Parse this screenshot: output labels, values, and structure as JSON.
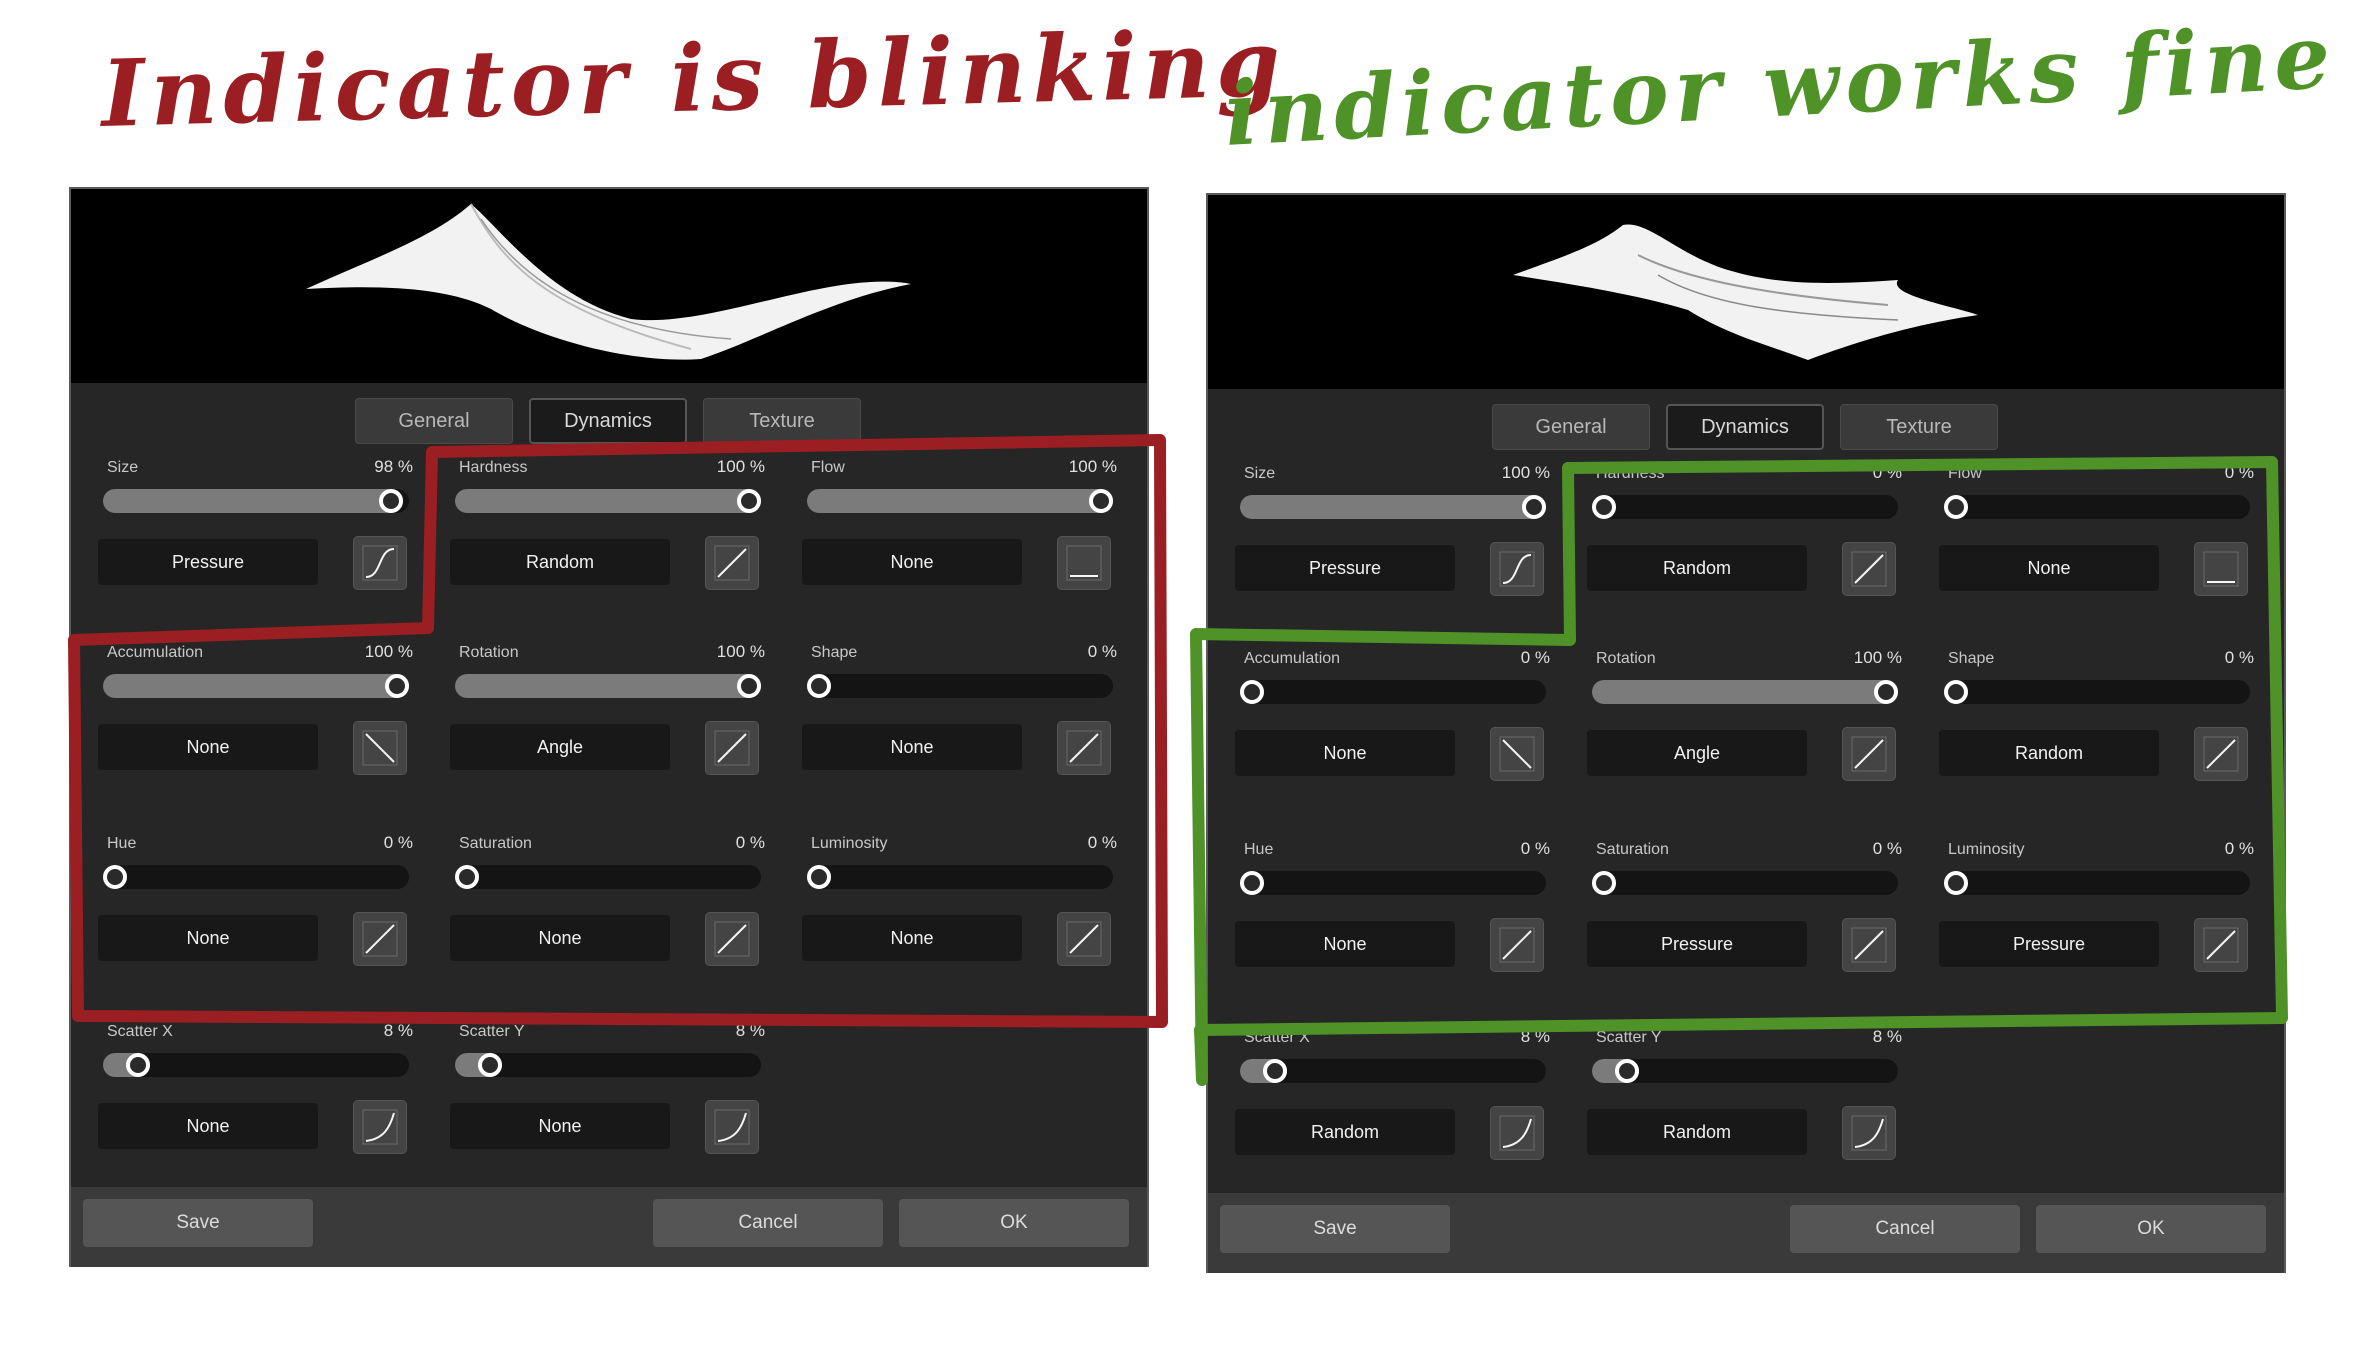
{
  "captions": {
    "left": "Indicator is blinking",
    "right": "indicator works fine"
  },
  "colors": {
    "left_annotation": "#9b1e22",
    "right_annotation": "#4e9228",
    "panel_bg": "#262626",
    "slider_fill": "#7b7b7b"
  },
  "left_panel": {
    "tabs": [
      "General",
      "Dynamics",
      "Texture"
    ],
    "active_tab": "Dynamics",
    "params": [
      {
        "label": "Size",
        "value": "98 %",
        "level": 0.98,
        "mode": "Pressure",
        "curve": "s-curve-icon"
      },
      {
        "label": "Hardness",
        "value": "100 %",
        "level": 1.0,
        "mode": "Random",
        "curve": "linear-curve-icon"
      },
      {
        "label": "Flow",
        "value": "100 %",
        "level": 1.0,
        "mode": "None",
        "curve": "flat-curve-icon"
      },
      {
        "label": "Accumulation",
        "value": "100 %",
        "level": 1.0,
        "mode": "None",
        "curve": "inverse-curve-icon"
      },
      {
        "label": "Rotation",
        "value": "100 %",
        "level": 1.0,
        "mode": "Angle",
        "curve": "linear-curve-icon"
      },
      {
        "label": "Shape",
        "value": "0 %",
        "level": 0.0,
        "mode": "None",
        "curve": "linear-curve-icon"
      },
      {
        "label": "Hue",
        "value": "0 %",
        "level": 0.0,
        "mode": "None",
        "curve": "linear-curve-icon"
      },
      {
        "label": "Saturation",
        "value": "0 %",
        "level": 0.0,
        "mode": "None",
        "curve": "linear-curve-icon"
      },
      {
        "label": "Luminosity",
        "value": "0 %",
        "level": 0.0,
        "mode": "None",
        "curve": "linear-curve-icon"
      },
      {
        "label": "Scatter X",
        "value": "8 %",
        "level": 0.08,
        "mode": "None",
        "curve": "concave-curve-icon"
      },
      {
        "label": "Scatter Y",
        "value": "8 %",
        "level": 0.08,
        "mode": "None",
        "curve": "concave-curve-icon"
      }
    ],
    "footer": {
      "save": "Save",
      "cancel": "Cancel",
      "ok": "OK"
    }
  },
  "right_panel": {
    "tabs": [
      "General",
      "Dynamics",
      "Texture"
    ],
    "active_tab": "Dynamics",
    "params": [
      {
        "label": "Size",
        "value": "100 %",
        "level": 1.0,
        "mode": "Pressure",
        "curve": "s-curve-icon"
      },
      {
        "label": "Hardness",
        "value": "0 %",
        "level": 0.0,
        "mode": "Random",
        "curve": "linear-curve-icon"
      },
      {
        "label": "Flow",
        "value": "0 %",
        "level": 0.0,
        "mode": "None",
        "curve": "flat-curve-icon"
      },
      {
        "label": "Accumulation",
        "value": "0 %",
        "level": 0.0,
        "mode": "None",
        "curve": "inverse-curve-icon"
      },
      {
        "label": "Rotation",
        "value": "100 %",
        "level": 1.0,
        "mode": "Angle",
        "curve": "linear-curve-icon"
      },
      {
        "label": "Shape",
        "value": "0 %",
        "level": 0.0,
        "mode": "Random",
        "curve": "linear-curve-icon"
      },
      {
        "label": "Hue",
        "value": "0 %",
        "level": 0.0,
        "mode": "None",
        "curve": "linear-curve-icon"
      },
      {
        "label": "Saturation",
        "value": "0 %",
        "level": 0.0,
        "mode": "Pressure",
        "curve": "linear-curve-icon"
      },
      {
        "label": "Luminosity",
        "value": "0 %",
        "level": 0.0,
        "mode": "Pressure",
        "curve": "linear-curve-icon"
      },
      {
        "label": "Scatter X",
        "value": "8 %",
        "level": 0.08,
        "mode": "Random",
        "curve": "concave-curve-icon"
      },
      {
        "label": "Scatter Y",
        "value": "8 %",
        "level": 0.08,
        "mode": "Random",
        "curve": "concave-curve-icon"
      }
    ],
    "footer": {
      "save": "Save",
      "cancel": "Cancel",
      "ok": "OK"
    }
  }
}
